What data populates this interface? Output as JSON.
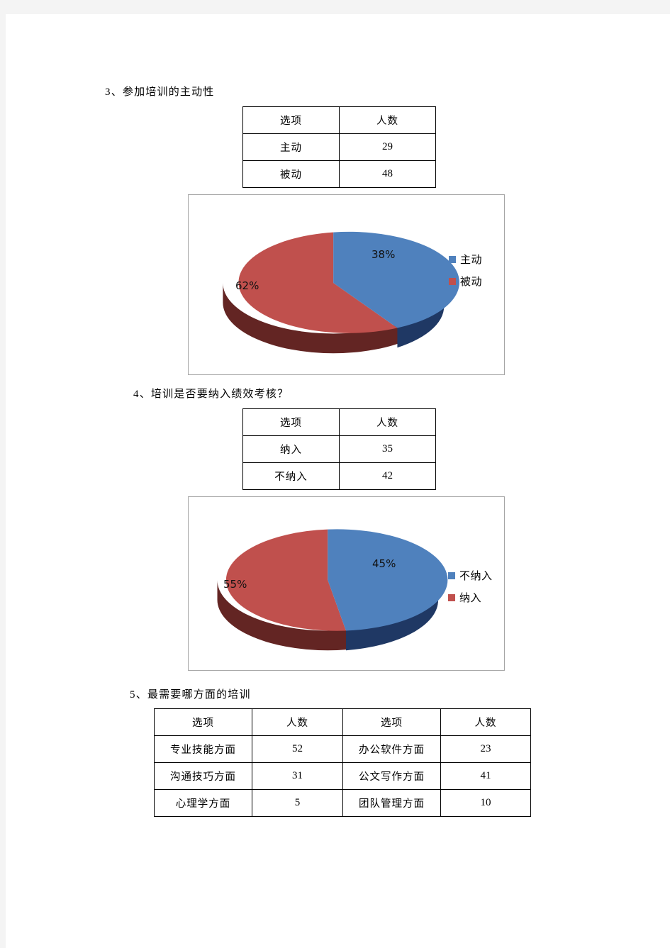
{
  "page": {
    "background": "#f4f4f4",
    "paper": "#ffffff"
  },
  "colors": {
    "blue": "#4F81BD",
    "blue_dark": "#1F3864",
    "red": "#C0504D",
    "red_dark": "#632523",
    "frame_border": "#A6A6A6",
    "table_border": "#000000"
  },
  "sections": [
    {
      "heading": "3、参加培训的主动性",
      "table": {
        "headers": [
          "选项",
          "人数"
        ],
        "rows": [
          [
            "主动",
            "29"
          ],
          [
            "被动",
            "48"
          ]
        ]
      }
    },
    {
      "heading": "4、培训是否要纳入绩效考核？",
      "table": {
        "headers": [
          "选项",
          "人数"
        ],
        "rows": [
          [
            "纳入",
            "35"
          ],
          [
            "不纳入",
            "42"
          ]
        ]
      }
    },
    {
      "heading": "5、最需要哪方面的培训",
      "table": {
        "headers": [
          "选项",
          "人数",
          "选项",
          "人数"
        ],
        "rows": [
          [
            "专业技能方面",
            "52",
            "办公软件方面",
            "23"
          ],
          [
            "沟通技巧方面",
            "31",
            "公文写作方面",
            "41"
          ],
          [
            "心理学方面",
            "5",
            "团队管理方面",
            "10"
          ]
        ]
      }
    }
  ],
  "chart_data": [
    {
      "type": "pie",
      "title": "",
      "three_d": true,
      "labels": [
        "主动",
        "被动"
      ],
      "values": [
        29,
        48
      ],
      "percent_labels": [
        "38%",
        "62%"
      ],
      "colors": [
        "#4F81BD",
        "#C0504D"
      ],
      "legend": {
        "position": "right",
        "entries": [
          "主动",
          "被动"
        ]
      }
    },
    {
      "type": "pie",
      "title": "",
      "three_d": true,
      "labels": [
        "不纳入",
        "纳入"
      ],
      "values": [
        35,
        42
      ],
      "percent_labels": [
        "45%",
        "55%"
      ],
      "colors": [
        "#4F81BD",
        "#C0504D"
      ],
      "legend": {
        "position": "right",
        "entries": [
          "不纳入",
          "纳入"
        ]
      }
    }
  ]
}
